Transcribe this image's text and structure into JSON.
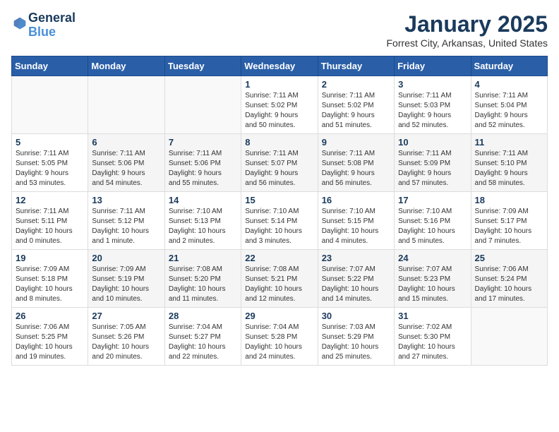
{
  "header": {
    "logo_line1": "General",
    "logo_line2": "Blue",
    "month": "January 2025",
    "location": "Forrest City, Arkansas, United States"
  },
  "days_of_week": [
    "Sunday",
    "Monday",
    "Tuesday",
    "Wednesday",
    "Thursday",
    "Friday",
    "Saturday"
  ],
  "weeks": [
    [
      {
        "day": "",
        "info": ""
      },
      {
        "day": "",
        "info": ""
      },
      {
        "day": "",
        "info": ""
      },
      {
        "day": "1",
        "info": "Sunrise: 7:11 AM\nSunset: 5:02 PM\nDaylight: 9 hours\nand 50 minutes."
      },
      {
        "day": "2",
        "info": "Sunrise: 7:11 AM\nSunset: 5:02 PM\nDaylight: 9 hours\nand 51 minutes."
      },
      {
        "day": "3",
        "info": "Sunrise: 7:11 AM\nSunset: 5:03 PM\nDaylight: 9 hours\nand 52 minutes."
      },
      {
        "day": "4",
        "info": "Sunrise: 7:11 AM\nSunset: 5:04 PM\nDaylight: 9 hours\nand 52 minutes."
      }
    ],
    [
      {
        "day": "5",
        "info": "Sunrise: 7:11 AM\nSunset: 5:05 PM\nDaylight: 9 hours\nand 53 minutes."
      },
      {
        "day": "6",
        "info": "Sunrise: 7:11 AM\nSunset: 5:06 PM\nDaylight: 9 hours\nand 54 minutes."
      },
      {
        "day": "7",
        "info": "Sunrise: 7:11 AM\nSunset: 5:06 PM\nDaylight: 9 hours\nand 55 minutes."
      },
      {
        "day": "8",
        "info": "Sunrise: 7:11 AM\nSunset: 5:07 PM\nDaylight: 9 hours\nand 56 minutes."
      },
      {
        "day": "9",
        "info": "Sunrise: 7:11 AM\nSunset: 5:08 PM\nDaylight: 9 hours\nand 56 minutes."
      },
      {
        "day": "10",
        "info": "Sunrise: 7:11 AM\nSunset: 5:09 PM\nDaylight: 9 hours\nand 57 minutes."
      },
      {
        "day": "11",
        "info": "Sunrise: 7:11 AM\nSunset: 5:10 PM\nDaylight: 9 hours\nand 58 minutes."
      }
    ],
    [
      {
        "day": "12",
        "info": "Sunrise: 7:11 AM\nSunset: 5:11 PM\nDaylight: 10 hours\nand 0 minutes."
      },
      {
        "day": "13",
        "info": "Sunrise: 7:11 AM\nSunset: 5:12 PM\nDaylight: 10 hours\nand 1 minute."
      },
      {
        "day": "14",
        "info": "Sunrise: 7:10 AM\nSunset: 5:13 PM\nDaylight: 10 hours\nand 2 minutes."
      },
      {
        "day": "15",
        "info": "Sunrise: 7:10 AM\nSunset: 5:14 PM\nDaylight: 10 hours\nand 3 minutes."
      },
      {
        "day": "16",
        "info": "Sunrise: 7:10 AM\nSunset: 5:15 PM\nDaylight: 10 hours\nand 4 minutes."
      },
      {
        "day": "17",
        "info": "Sunrise: 7:10 AM\nSunset: 5:16 PM\nDaylight: 10 hours\nand 5 minutes."
      },
      {
        "day": "18",
        "info": "Sunrise: 7:09 AM\nSunset: 5:17 PM\nDaylight: 10 hours\nand 7 minutes."
      }
    ],
    [
      {
        "day": "19",
        "info": "Sunrise: 7:09 AM\nSunset: 5:18 PM\nDaylight: 10 hours\nand 8 minutes."
      },
      {
        "day": "20",
        "info": "Sunrise: 7:09 AM\nSunset: 5:19 PM\nDaylight: 10 hours\nand 10 minutes."
      },
      {
        "day": "21",
        "info": "Sunrise: 7:08 AM\nSunset: 5:20 PM\nDaylight: 10 hours\nand 11 minutes."
      },
      {
        "day": "22",
        "info": "Sunrise: 7:08 AM\nSunset: 5:21 PM\nDaylight: 10 hours\nand 12 minutes."
      },
      {
        "day": "23",
        "info": "Sunrise: 7:07 AM\nSunset: 5:22 PM\nDaylight: 10 hours\nand 14 minutes."
      },
      {
        "day": "24",
        "info": "Sunrise: 7:07 AM\nSunset: 5:23 PM\nDaylight: 10 hours\nand 15 minutes."
      },
      {
        "day": "25",
        "info": "Sunrise: 7:06 AM\nSunset: 5:24 PM\nDaylight: 10 hours\nand 17 minutes."
      }
    ],
    [
      {
        "day": "26",
        "info": "Sunrise: 7:06 AM\nSunset: 5:25 PM\nDaylight: 10 hours\nand 19 minutes."
      },
      {
        "day": "27",
        "info": "Sunrise: 7:05 AM\nSunset: 5:26 PM\nDaylight: 10 hours\nand 20 minutes."
      },
      {
        "day": "28",
        "info": "Sunrise: 7:04 AM\nSunset: 5:27 PM\nDaylight: 10 hours\nand 22 minutes."
      },
      {
        "day": "29",
        "info": "Sunrise: 7:04 AM\nSunset: 5:28 PM\nDaylight: 10 hours\nand 24 minutes."
      },
      {
        "day": "30",
        "info": "Sunrise: 7:03 AM\nSunset: 5:29 PM\nDaylight: 10 hours\nand 25 minutes."
      },
      {
        "day": "31",
        "info": "Sunrise: 7:02 AM\nSunset: 5:30 PM\nDaylight: 10 hours\nand 27 minutes."
      },
      {
        "day": "",
        "info": ""
      }
    ]
  ]
}
